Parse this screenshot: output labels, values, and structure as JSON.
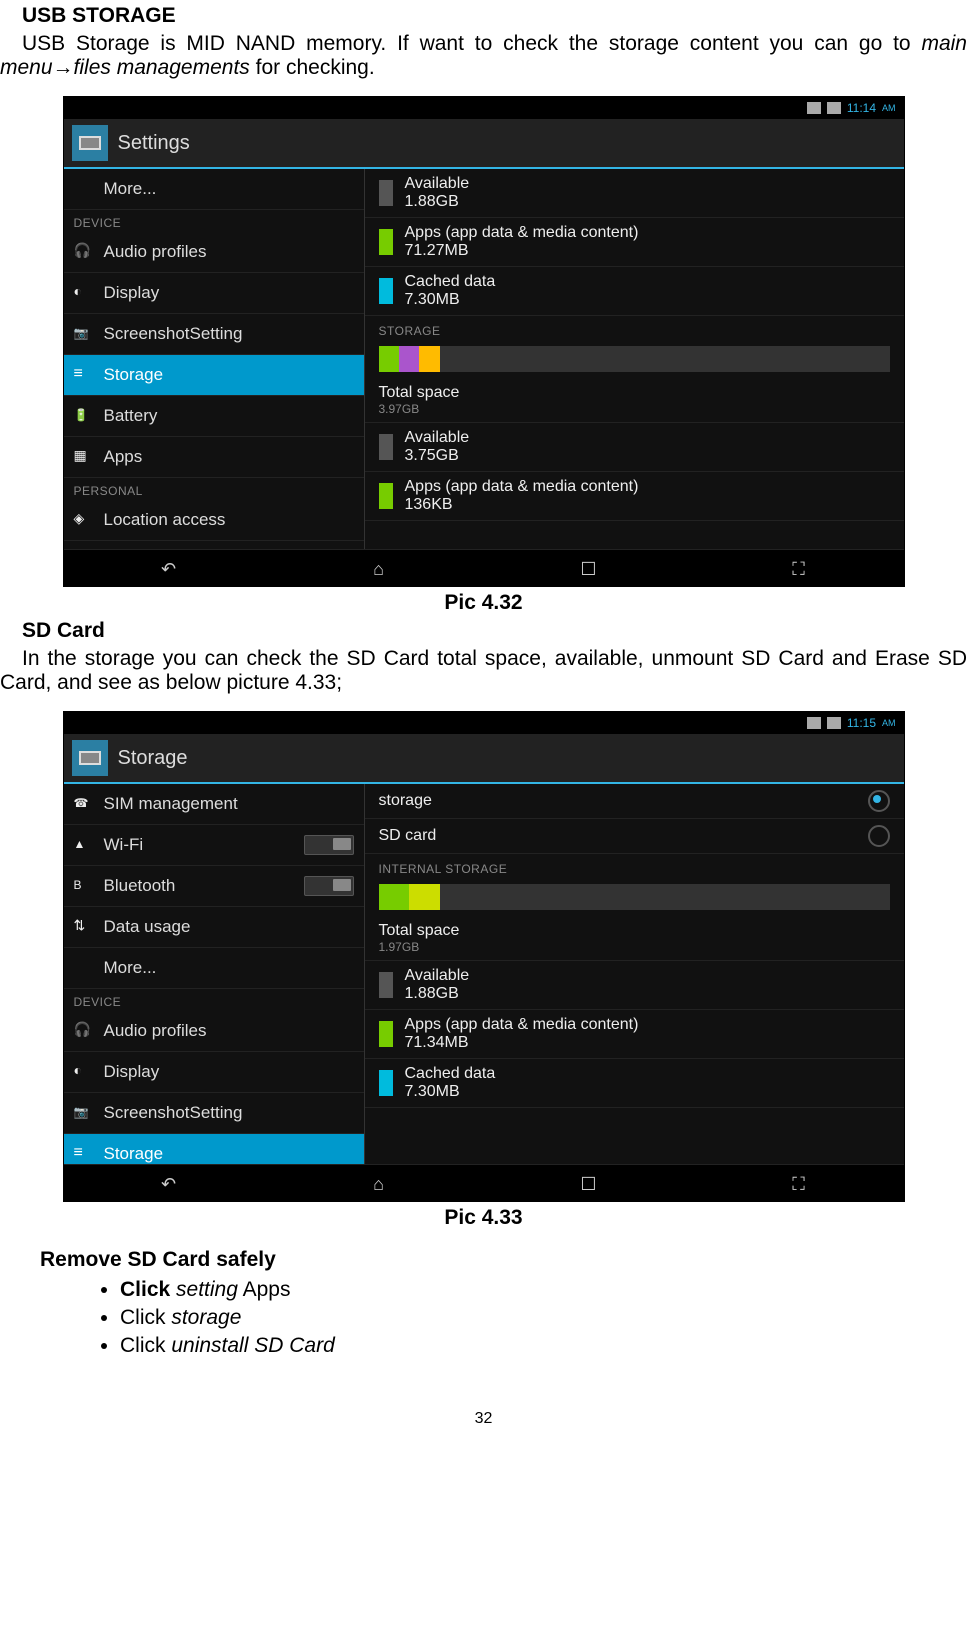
{
  "doc": {
    "h1": "USB STORAGE",
    "p1a": "USB Storage is MID NAND memory. If want to check the storage content you can go to ",
    "p1b": "main menu",
    "p1arrow": "→",
    "p1c": "files managements",
    "p1d": " for checking.",
    "cap1": "Pic 4.32",
    "h2": "SD Card",
    "p2": "In the storage you can check the SD Card total space, available, unmount SD Card and Erase SD Card, and see as below picture 4.33;",
    "cap2": "Pic 4.33",
    "h3": "Remove SD Card safely",
    "b1bold": "Click",
    "b1it": " setting",
    "b1rest": " Apps",
    "b2a": "Click ",
    "b2b": "storage",
    "b3a": "Click   ",
    "b3b": "uninstall SD Card",
    "pagenum": "32"
  },
  "shot1": {
    "time": "11:14",
    "ampm": "AM",
    "title": "Settings",
    "left": {
      "more": "More...",
      "cat_device": "DEVICE",
      "audio": "Audio profiles",
      "display": "Display",
      "sshot": "ScreenshotSetting",
      "storage": "Storage",
      "battery": "Battery",
      "apps": "Apps",
      "cat_personal": "PERSONAL",
      "location": "Location access"
    },
    "right": {
      "avail_t": "Available",
      "avail_v": "1.88GB",
      "apps_t": "Apps (app data & media content)",
      "apps_v": "71.27MB",
      "cache_t": "Cached data",
      "cache_v": "7.30MB",
      "sect": "STORAGE",
      "total_t": "Total space",
      "total_v": "3.97GB",
      "avail2_t": "Available",
      "avail2_v": "3.75GB",
      "apps2_t": "Apps (app data & media content)",
      "apps2_v": "136KB"
    }
  },
  "shot2": {
    "time": "11:15",
    "ampm": "AM",
    "title": "Storage",
    "left": {
      "sim": "SIM management",
      "wifi": "Wi-Fi",
      "bt": "Bluetooth",
      "data": "Data usage",
      "more": "More...",
      "cat_device": "DEVICE",
      "audio": "Audio profiles",
      "display": "Display",
      "sshot": "ScreenshotSetting",
      "storage": "Storage"
    },
    "right": {
      "storage_t": "storage",
      "sd_t": "SD card",
      "sect": "INTERNAL STORAGE",
      "total_t": "Total space",
      "total_v": "1.97GB",
      "avail_t": "Available",
      "avail_v": "1.88GB",
      "apps_t": "Apps (app data & media content)",
      "apps_v": "71.34MB",
      "cache_t": "Cached data",
      "cache_v": "7.30MB"
    }
  }
}
